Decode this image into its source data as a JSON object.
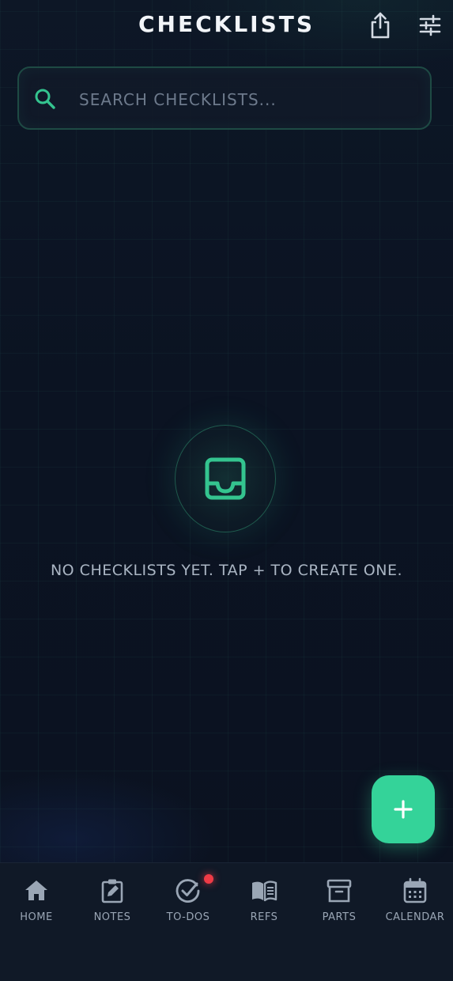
{
  "header": {
    "title": "CHECKLISTS",
    "share_icon": "share-icon",
    "filter_icon": "sliders-icon"
  },
  "search": {
    "placeholder": "SEARCH CHECKLISTS...",
    "value": "",
    "icon": "search-icon"
  },
  "empty_state": {
    "icon": "inbox-icon",
    "message": "NO CHECKLISTS YET. TAP + TO CREATE ONE."
  },
  "fab": {
    "icon": "plus-icon"
  },
  "nav": {
    "items": [
      {
        "label": "HOME",
        "icon": "home-icon"
      },
      {
        "label": "NOTES",
        "icon": "clipboard-edit-icon"
      },
      {
        "label": "TO-DOS",
        "icon": "check-circle-icon",
        "badge": true
      },
      {
        "label": "REFS",
        "icon": "book-open-icon"
      },
      {
        "label": "PARTS",
        "icon": "archive-box-icon"
      },
      {
        "label": "CALENDAR",
        "icon": "calendar-icon"
      }
    ]
  },
  "colors": {
    "background": "#0b1220",
    "accent": "#34d399",
    "badge": "#ef3b46",
    "nav_background": "#101927",
    "text_primary": "#f2f5f9",
    "text_muted": "#9aa6b5"
  }
}
